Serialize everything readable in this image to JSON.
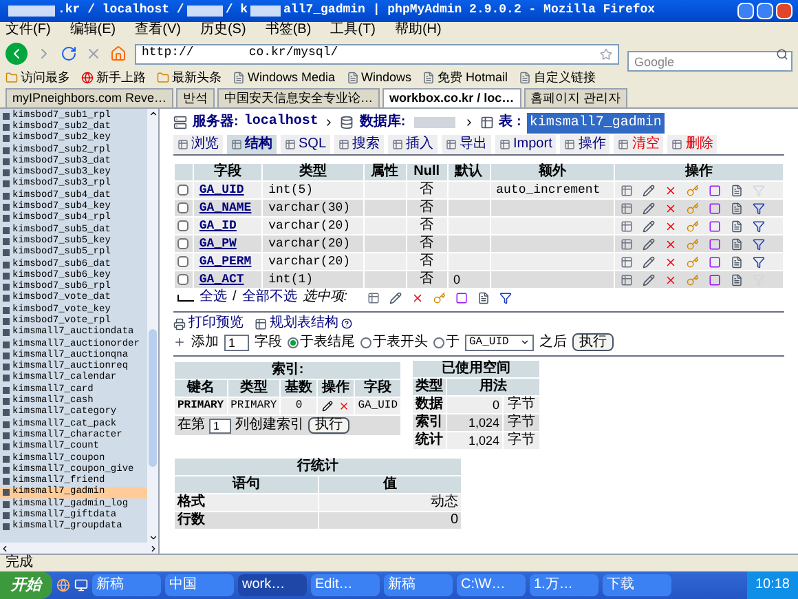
{
  "window": {
    "title_parts": [
      ".kr / localhost / ",
      " / k",
      "all7_gadmin | phpMyAdmin 2.9.0.2 - Mozilla Firefox"
    ]
  },
  "menu": [
    "文件(F)",
    "编辑(E)",
    "查看(V)",
    "历史(S)",
    "书签(B)",
    "工具(T)",
    "帮助(H)"
  ],
  "address": {
    "parts": [
      "http://",
      "co.kr/mysql/"
    ]
  },
  "search": {
    "placeholder": "Google"
  },
  "bookmarks": [
    {
      "label": "访问最多",
      "kind": "folder"
    },
    {
      "label": "新手上路",
      "kind": "site"
    },
    {
      "label": "最新头条",
      "kind": "folder"
    },
    {
      "label": "Windows Media",
      "kind": "page"
    },
    {
      "label": "Windows",
      "kind": "page"
    },
    {
      "label": "免费 Hotmail",
      "kind": "page"
    },
    {
      "label": "自定义链接",
      "kind": "page"
    }
  ],
  "browser_tabs": [
    {
      "label": "myIPneighbors.com Reve…",
      "selected": false
    },
    {
      "label": "반석",
      "selected": false
    },
    {
      "label": "中国安天信息安全专业论…",
      "selected": false
    },
    {
      "label": "workbox.co.kr / loc…",
      "selected": true
    },
    {
      "label": "홈페이지 관리자",
      "selected": false
    }
  ],
  "sidebar": {
    "items": [
      {
        "name": "kimsbod7_sub1_rpl",
        "selected": false
      },
      {
        "name": "kimsbod7_sub2_dat",
        "selected": false
      },
      {
        "name": "kimsbod7_sub2_key",
        "selected": false
      },
      {
        "name": "kimsbod7_sub2_rpl",
        "selected": false
      },
      {
        "name": "kimsbod7_sub3_dat",
        "selected": false
      },
      {
        "name": "kimsbod7_sub3_key",
        "selected": false
      },
      {
        "name": "kimsbod7_sub3_rpl",
        "selected": false
      },
      {
        "name": "kimsbod7_sub4_dat",
        "selected": false
      },
      {
        "name": "kimsbod7_sub4_key",
        "selected": false
      },
      {
        "name": "kimsbod7_sub4_rpl",
        "selected": false
      },
      {
        "name": "kimsbod7_sub5_dat",
        "selected": false
      },
      {
        "name": "kimsbod7_sub5_key",
        "selected": false
      },
      {
        "name": "kimsbod7_sub5_rpl",
        "selected": false
      },
      {
        "name": "kimsbod7_sub6_dat",
        "selected": false
      },
      {
        "name": "kimsbod7_sub6_key",
        "selected": false
      },
      {
        "name": "kimsbod7_sub6_rpl",
        "selected": false
      },
      {
        "name": "kimsbod7_vote_dat",
        "selected": false
      },
      {
        "name": "kimsbod7_vote_key",
        "selected": false
      },
      {
        "name": "kimsbod7_vote_rpl",
        "selected": false
      },
      {
        "name": "kimsmall7_auctiondata",
        "selected": false
      },
      {
        "name": "kimsmall7_auctionorder",
        "selected": false
      },
      {
        "name": "kimsmall7_auctionqna",
        "selected": false
      },
      {
        "name": "kimsmall7_auctionreq",
        "selected": false
      },
      {
        "name": "kimsmall7_calendar",
        "selected": false
      },
      {
        "name": "kimsmall7_card",
        "selected": false
      },
      {
        "name": "kimsmall7_cash",
        "selected": false
      },
      {
        "name": "kimsmall7_category",
        "selected": false
      },
      {
        "name": "kimsmall7_cat_pack",
        "selected": false
      },
      {
        "name": "kimsmall7_character",
        "selected": false
      },
      {
        "name": "kimsmall7_count",
        "selected": false
      },
      {
        "name": "kimsmall7_coupon",
        "selected": false
      },
      {
        "name": "kimsmall7_coupon_give",
        "selected": false
      },
      {
        "name": "kimsmall7_friend",
        "selected": false
      },
      {
        "name": "kimsmall7_gadmin",
        "selected": true
      },
      {
        "name": "kimsmall7_gadmin_log",
        "selected": false
      },
      {
        "name": "kimsmall7_giftdata",
        "selected": false
      },
      {
        "name": "kimsmall7_groupdata",
        "selected": false
      }
    ]
  },
  "breadcrumb": {
    "server_label": "服务器:",
    "server": "localhost",
    "db_label": "数据库:",
    "table_label": "表 :",
    "table": "kimsmall7_gadmin"
  },
  "tabs": [
    {
      "label": "浏览",
      "selected": false,
      "kind": "normal"
    },
    {
      "label": "结构",
      "selected": true,
      "kind": "normal"
    },
    {
      "label": "SQL",
      "selected": false,
      "kind": "normal"
    },
    {
      "label": "搜索",
      "selected": false,
      "kind": "normal"
    },
    {
      "label": "插入",
      "selected": false,
      "kind": "normal"
    },
    {
      "label": "导出",
      "selected": false,
      "kind": "normal"
    },
    {
      "label": "Import",
      "selected": false,
      "kind": "normal"
    },
    {
      "label": "操作",
      "selected": false,
      "kind": "normal"
    },
    {
      "label": "清空",
      "selected": false,
      "kind": "danger"
    },
    {
      "label": "删除",
      "selected": false,
      "kind": "danger"
    }
  ],
  "fields_table": {
    "columns": [
      "字段",
      "类型",
      "属性",
      "Null",
      "默认",
      "额外",
      "操作"
    ],
    "rows": [
      {
        "field": "GA_UID",
        "type": "int(5)",
        "null": "否",
        "default": "",
        "extra": "auto_increment",
        "checked": false,
        "fulltext_enabled": false
      },
      {
        "field": "GA_NAME",
        "type": "varchar(30)",
        "null": "否",
        "default": "",
        "extra": "",
        "checked": false,
        "fulltext_enabled": true
      },
      {
        "field": "GA_ID",
        "type": "varchar(20)",
        "null": "否",
        "default": "",
        "extra": "",
        "checked": false,
        "fulltext_enabled": true
      },
      {
        "field": "GA_PW",
        "type": "varchar(20)",
        "null": "否",
        "default": "",
        "extra": "",
        "checked": false,
        "fulltext_enabled": true
      },
      {
        "field": "GA_PERM",
        "type": "varchar(20)",
        "null": "否",
        "default": "",
        "extra": "",
        "checked": false,
        "fulltext_enabled": true
      },
      {
        "field": "GA_ACT",
        "type": "int(1)",
        "null": "否",
        "default": "0",
        "extra": "",
        "checked": false,
        "fulltext_enabled": false
      }
    ],
    "select_all": "全选",
    "separator": "/",
    "select_none": "全部不选",
    "with_selected": "选中项:"
  },
  "links": [
    "打印预览",
    "规划表结构"
  ],
  "add_fields": {
    "label": "添加",
    "count": "1",
    "unit": "字段",
    "options": [
      {
        "label": "于表结尾",
        "selected": true
      },
      {
        "label": "于表开头",
        "selected": false
      },
      {
        "label": "于",
        "selected": false
      }
    ],
    "after_field": "GA_UID",
    "after_label": "之后",
    "button": "执行"
  },
  "indexes": {
    "title": "索引:",
    "columns": [
      "键名",
      "类型",
      "基数",
      "操作",
      "字段"
    ],
    "rows": [
      {
        "key": "PRIMARY",
        "type": "PRIMARY",
        "cardinality": "0",
        "field": "GA_UID"
      }
    ],
    "create_prefix": "在第",
    "create_count": "1",
    "create_suffix": "列创建索引",
    "button": "执行"
  },
  "space": {
    "title": "已使用空间",
    "columns": [
      "类型",
      "用法"
    ],
    "rows": [
      {
        "type": "数据",
        "value": "0",
        "unit": "字节"
      },
      {
        "type": "索引",
        "value": "1,024",
        "unit": "字节"
      },
      {
        "type": "统计",
        "value": "1,024",
        "unit": "字节"
      }
    ]
  },
  "row_stats": {
    "title": "行统计",
    "columns": [
      "语句",
      "值"
    ],
    "rows": [
      {
        "label": "格式",
        "value": "动态"
      },
      {
        "label": "行数",
        "value": "0"
      }
    ]
  },
  "status_bar": "完成",
  "taskbar": {
    "start": "开始",
    "items": [
      {
        "label": "新稿",
        "selected": false
      },
      {
        "label": "中国",
        "selected": false
      },
      {
        "label": "work…",
        "selected": true
      },
      {
        "label": "Edit…",
        "selected": false
      },
      {
        "label": "新稿",
        "selected": false
      },
      {
        "label": "C:\\W…",
        "selected": false
      },
      {
        "label": "1.万…",
        "selected": false
      },
      {
        "label": "下载",
        "selected": false
      }
    ],
    "clock": "10:18"
  }
}
